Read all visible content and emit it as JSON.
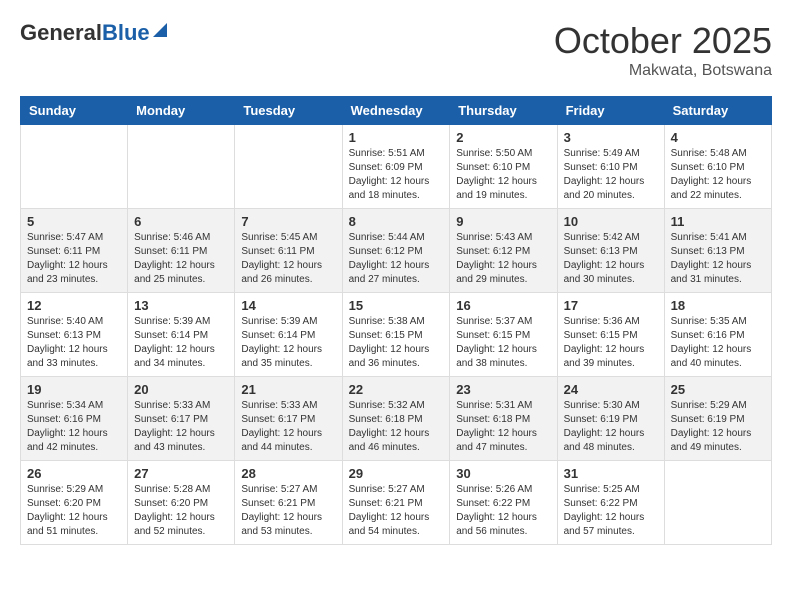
{
  "header": {
    "logo_general": "General",
    "logo_blue": "Blue",
    "month": "October 2025",
    "location": "Makwata, Botswana"
  },
  "weekdays": [
    "Sunday",
    "Monday",
    "Tuesday",
    "Wednesday",
    "Thursday",
    "Friday",
    "Saturday"
  ],
  "weeks": [
    [
      {
        "day": "",
        "info": ""
      },
      {
        "day": "",
        "info": ""
      },
      {
        "day": "",
        "info": ""
      },
      {
        "day": "1",
        "info": "Sunrise: 5:51 AM\nSunset: 6:09 PM\nDaylight: 12 hours\nand 18 minutes."
      },
      {
        "day": "2",
        "info": "Sunrise: 5:50 AM\nSunset: 6:10 PM\nDaylight: 12 hours\nand 19 minutes."
      },
      {
        "day": "3",
        "info": "Sunrise: 5:49 AM\nSunset: 6:10 PM\nDaylight: 12 hours\nand 20 minutes."
      },
      {
        "day": "4",
        "info": "Sunrise: 5:48 AM\nSunset: 6:10 PM\nDaylight: 12 hours\nand 22 minutes."
      }
    ],
    [
      {
        "day": "5",
        "info": "Sunrise: 5:47 AM\nSunset: 6:11 PM\nDaylight: 12 hours\nand 23 minutes."
      },
      {
        "day": "6",
        "info": "Sunrise: 5:46 AM\nSunset: 6:11 PM\nDaylight: 12 hours\nand 25 minutes."
      },
      {
        "day": "7",
        "info": "Sunrise: 5:45 AM\nSunset: 6:11 PM\nDaylight: 12 hours\nand 26 minutes."
      },
      {
        "day": "8",
        "info": "Sunrise: 5:44 AM\nSunset: 6:12 PM\nDaylight: 12 hours\nand 27 minutes."
      },
      {
        "day": "9",
        "info": "Sunrise: 5:43 AM\nSunset: 6:12 PM\nDaylight: 12 hours\nand 29 minutes."
      },
      {
        "day": "10",
        "info": "Sunrise: 5:42 AM\nSunset: 6:13 PM\nDaylight: 12 hours\nand 30 minutes."
      },
      {
        "day": "11",
        "info": "Sunrise: 5:41 AM\nSunset: 6:13 PM\nDaylight: 12 hours\nand 31 minutes."
      }
    ],
    [
      {
        "day": "12",
        "info": "Sunrise: 5:40 AM\nSunset: 6:13 PM\nDaylight: 12 hours\nand 33 minutes."
      },
      {
        "day": "13",
        "info": "Sunrise: 5:39 AM\nSunset: 6:14 PM\nDaylight: 12 hours\nand 34 minutes."
      },
      {
        "day": "14",
        "info": "Sunrise: 5:39 AM\nSunset: 6:14 PM\nDaylight: 12 hours\nand 35 minutes."
      },
      {
        "day": "15",
        "info": "Sunrise: 5:38 AM\nSunset: 6:15 PM\nDaylight: 12 hours\nand 36 minutes."
      },
      {
        "day": "16",
        "info": "Sunrise: 5:37 AM\nSunset: 6:15 PM\nDaylight: 12 hours\nand 38 minutes."
      },
      {
        "day": "17",
        "info": "Sunrise: 5:36 AM\nSunset: 6:15 PM\nDaylight: 12 hours\nand 39 minutes."
      },
      {
        "day": "18",
        "info": "Sunrise: 5:35 AM\nSunset: 6:16 PM\nDaylight: 12 hours\nand 40 minutes."
      }
    ],
    [
      {
        "day": "19",
        "info": "Sunrise: 5:34 AM\nSunset: 6:16 PM\nDaylight: 12 hours\nand 42 minutes."
      },
      {
        "day": "20",
        "info": "Sunrise: 5:33 AM\nSunset: 6:17 PM\nDaylight: 12 hours\nand 43 minutes."
      },
      {
        "day": "21",
        "info": "Sunrise: 5:33 AM\nSunset: 6:17 PM\nDaylight: 12 hours\nand 44 minutes."
      },
      {
        "day": "22",
        "info": "Sunrise: 5:32 AM\nSunset: 6:18 PM\nDaylight: 12 hours\nand 46 minutes."
      },
      {
        "day": "23",
        "info": "Sunrise: 5:31 AM\nSunset: 6:18 PM\nDaylight: 12 hours\nand 47 minutes."
      },
      {
        "day": "24",
        "info": "Sunrise: 5:30 AM\nSunset: 6:19 PM\nDaylight: 12 hours\nand 48 minutes."
      },
      {
        "day": "25",
        "info": "Sunrise: 5:29 AM\nSunset: 6:19 PM\nDaylight: 12 hours\nand 49 minutes."
      }
    ],
    [
      {
        "day": "26",
        "info": "Sunrise: 5:29 AM\nSunset: 6:20 PM\nDaylight: 12 hours\nand 51 minutes."
      },
      {
        "day": "27",
        "info": "Sunrise: 5:28 AM\nSunset: 6:20 PM\nDaylight: 12 hours\nand 52 minutes."
      },
      {
        "day": "28",
        "info": "Sunrise: 5:27 AM\nSunset: 6:21 PM\nDaylight: 12 hours\nand 53 minutes."
      },
      {
        "day": "29",
        "info": "Sunrise: 5:27 AM\nSunset: 6:21 PM\nDaylight: 12 hours\nand 54 minutes."
      },
      {
        "day": "30",
        "info": "Sunrise: 5:26 AM\nSunset: 6:22 PM\nDaylight: 12 hours\nand 56 minutes."
      },
      {
        "day": "31",
        "info": "Sunrise: 5:25 AM\nSunset: 6:22 PM\nDaylight: 12 hours\nand 57 minutes."
      },
      {
        "day": "",
        "info": ""
      }
    ]
  ]
}
